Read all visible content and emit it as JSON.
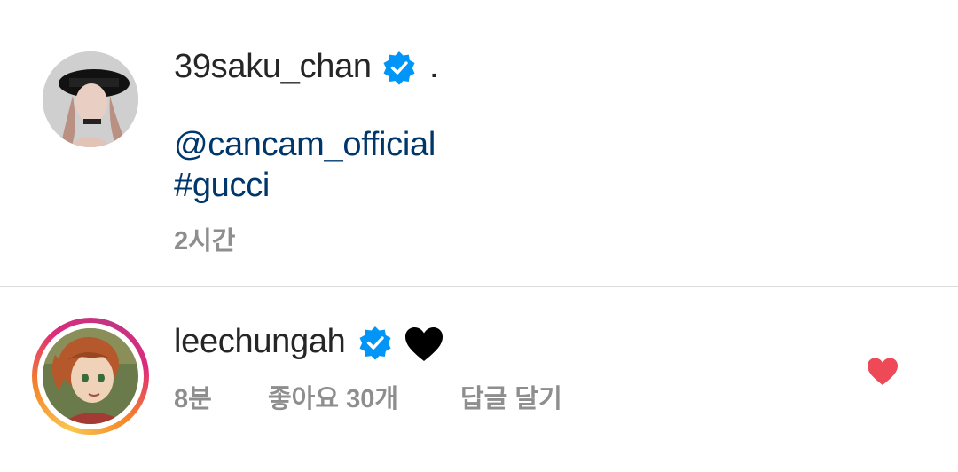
{
  "post": {
    "username": "39saku_chan",
    "caption_text": ".",
    "mention": "@cancam_official",
    "hashtag": "#gucci",
    "time": "2시간"
  },
  "comment": {
    "username": "leechungah",
    "text_icon": "black-heart-emoji",
    "time": "8분",
    "likes": "좋아요 30개",
    "reply_label": "답글 달기",
    "liked": true
  },
  "icons": {
    "verified": "verified-badge-icon",
    "like": "heart-icon"
  },
  "colors": {
    "link": "#00376b",
    "verified": "#0095f6",
    "liked_heart": "#ed4956",
    "meta": "#8e8e8e"
  }
}
